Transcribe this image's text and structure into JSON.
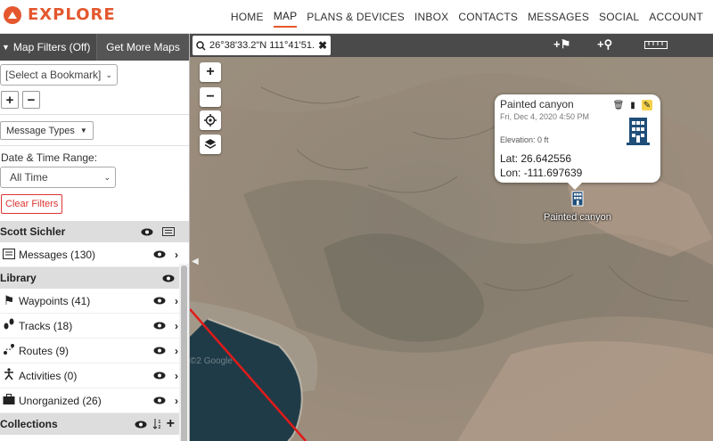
{
  "brand": {
    "name": "EXPLORE",
    "color": "#e4572e"
  },
  "nav": {
    "items": [
      "HOME",
      "MAP",
      "PLANS & DEVICES",
      "INBOX",
      "CONTACTS",
      "MESSAGES",
      "SOCIAL",
      "ACCOUNT"
    ],
    "active": "MAP"
  },
  "sidebar": {
    "filters_label": "Map Filters (Off)",
    "more_maps_label": "Get More Maps",
    "bookmark_select": "[Select a Bookmark]",
    "add_label": "+",
    "remove_label": "−",
    "message_types_label": "Message Types",
    "date_range_label": "Date & Time Range:",
    "date_range_value": "All Time",
    "clear_filters_label": "Clear Filters",
    "user_section": {
      "name": "Scott Sichler"
    },
    "messages_row": {
      "label": "Messages (130)"
    },
    "library_section": {
      "name": "Library"
    },
    "library_rows": [
      {
        "label": "Waypoints (41)",
        "icon": "flag-icon"
      },
      {
        "label": "Tracks (18)",
        "icon": "footprints-icon"
      },
      {
        "label": "Routes (9)",
        "icon": "route-icon"
      },
      {
        "label": "Activities (0)",
        "icon": "activity-icon"
      },
      {
        "label": "Unorganized (26)",
        "icon": "briefcase-icon"
      }
    ],
    "collections_section": {
      "name": "Collections"
    }
  },
  "map": {
    "coordinates": "26°38'33.2\"N 111°41'51.",
    "popup": {
      "title": "Painted canyon",
      "date": "Fri, Dec 4, 2020 4:50 PM",
      "elevation": "Elevation: 0 ft",
      "lat": "Lat: 26.642556",
      "lon": "Lon: -111.697639"
    },
    "marker_label": "Painted canyon",
    "watermark": "©2 Google"
  }
}
